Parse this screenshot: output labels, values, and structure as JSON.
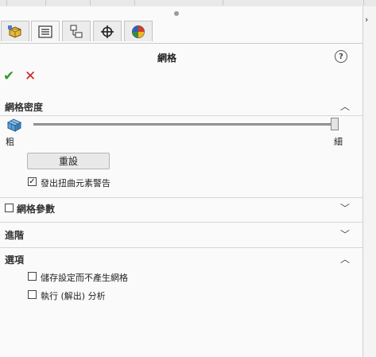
{
  "tabs": [
    {
      "icon": "feature-manager-icon"
    },
    {
      "icon": "property-manager-icon"
    },
    {
      "icon": "configuration-manager-icon"
    },
    {
      "icon": "dimxpert-manager-icon"
    },
    {
      "icon": "display-manager-icon"
    }
  ],
  "title": "網格",
  "help_label": "?",
  "ok_label": "✔",
  "cancel_label": "✕",
  "density": {
    "header": "網格密度",
    "coarse_label": "粗",
    "fine_label": "細",
    "slider_level": 1.0,
    "reset_label": "重設",
    "warn_label": "發出扭曲元素警告",
    "warn_checked": true
  },
  "params": {
    "header": "網格參數",
    "checked": false
  },
  "advanced": {
    "header": "進階"
  },
  "options": {
    "header": "選項",
    "save_label": "儲存設定而不產生網格",
    "save_checked": false,
    "run_label": "執行 (解出) 分析",
    "run_checked": false
  },
  "colors": {
    "ok": "#2d9b2d",
    "cancel": "#cc2222"
  }
}
